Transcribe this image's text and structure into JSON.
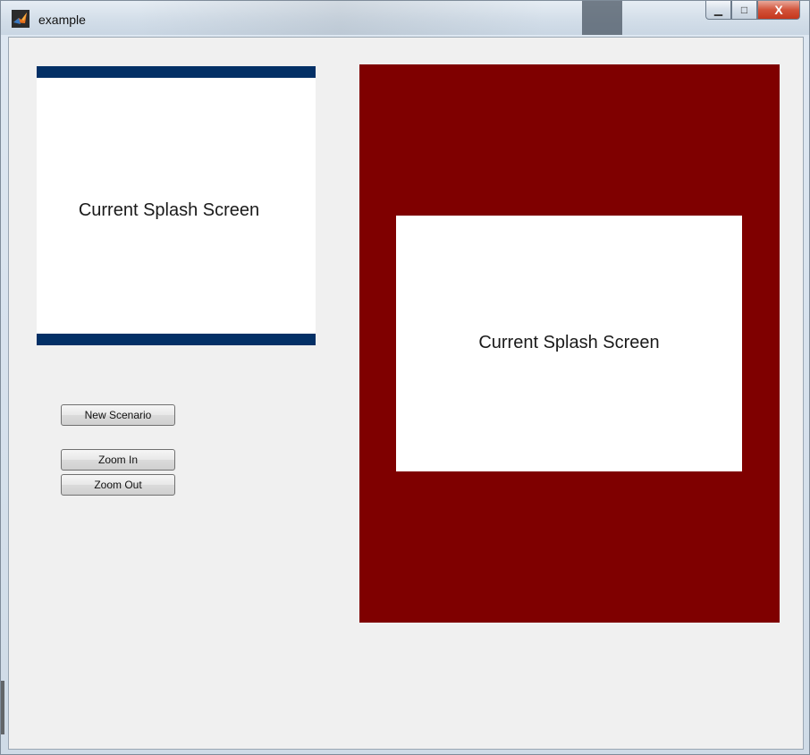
{
  "window": {
    "title": "example",
    "controls": {
      "minimize_icon": "minimize-icon",
      "maximize_icon": "maximize-icon",
      "close_icon": "close-icon",
      "minimize_glyph": "▁",
      "maximize_glyph": "□",
      "close_glyph": "X"
    }
  },
  "preview_small": {
    "label": "Current Splash Screen",
    "bar_color": "#033066"
  },
  "preview_large": {
    "label": "Current Splash Screen",
    "background_color": "#7f0000"
  },
  "buttons": {
    "new_scenario": "New Scenario",
    "zoom_in": "Zoom In",
    "zoom_out": "Zoom Out"
  }
}
